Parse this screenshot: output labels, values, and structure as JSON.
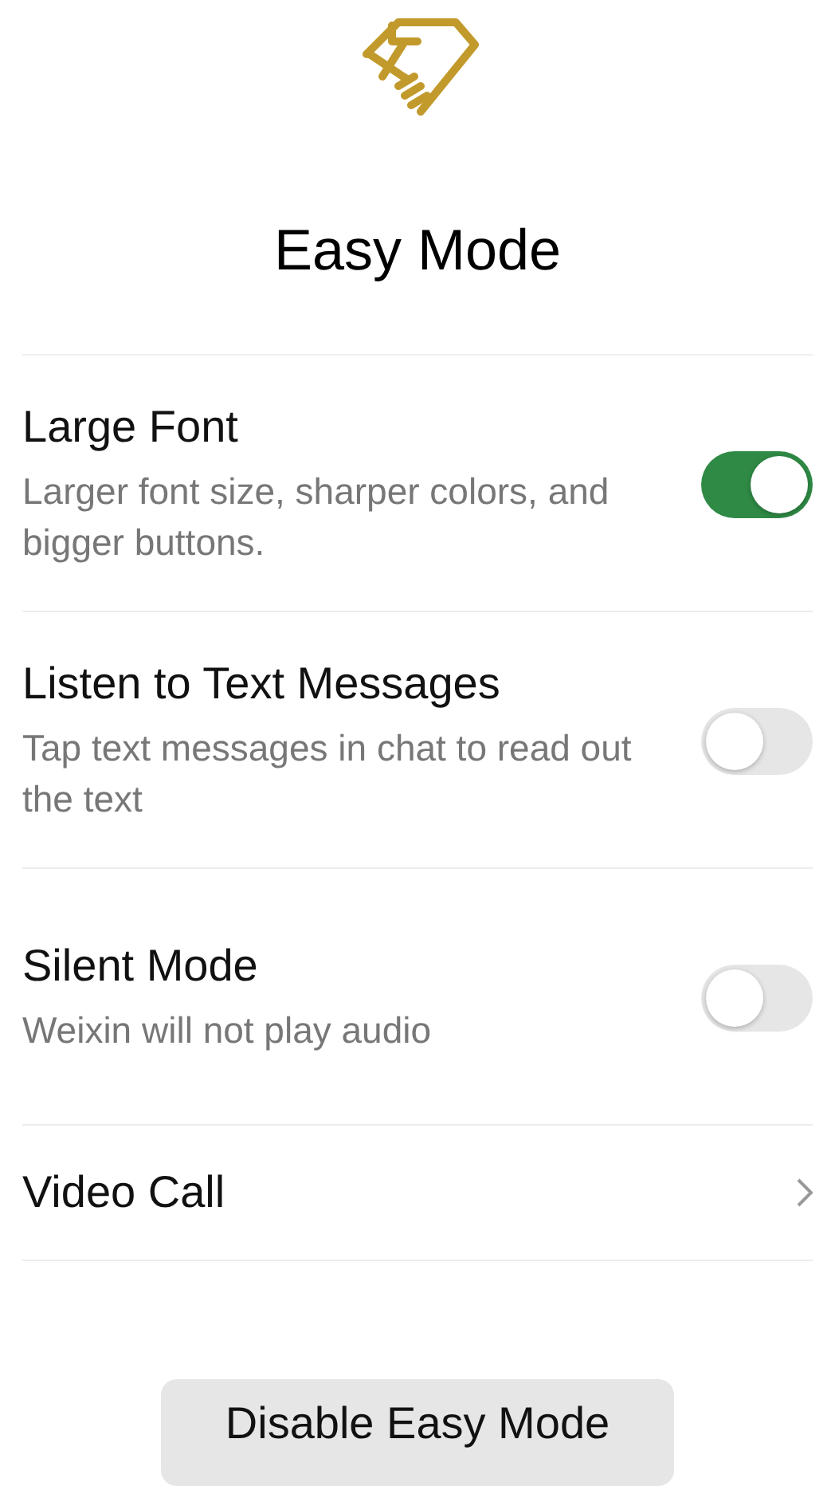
{
  "title": "Easy Mode",
  "settings": [
    {
      "kind": "toggle",
      "label": "Large Font",
      "description": "Larger font size, sharper colors, and bigger buttons.",
      "on": true
    },
    {
      "kind": "toggle",
      "label": "Listen to Text Messages",
      "description": "Tap text messages in chat to read out the text",
      "on": false
    },
    {
      "kind": "toggle",
      "label": "Silent Mode",
      "description": "Weixin will not play audio",
      "on": false
    },
    {
      "kind": "link",
      "label": "Video Call"
    }
  ],
  "button": "Disable Easy Mode"
}
